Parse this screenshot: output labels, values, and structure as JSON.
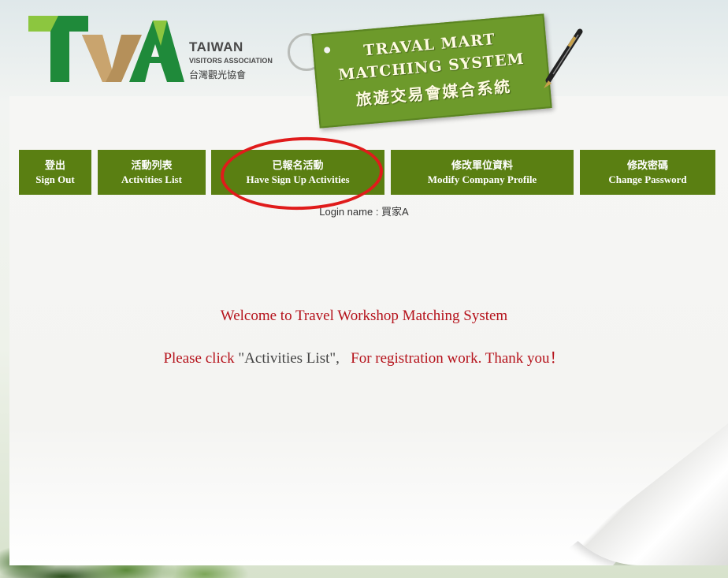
{
  "header": {
    "org_name_en": "TAIWAN",
    "org_subtitle_en": "VISITORS ASSOCIATION",
    "org_name_zh": "台灣觀光協會",
    "tag_line1": "TRAVAL MART",
    "tag_line2": "MATCHING SYSTEM",
    "tag_line3": "旅遊交易會媒合系統"
  },
  "nav": {
    "items": [
      {
        "zh": "登出",
        "en": "Sign Out"
      },
      {
        "zh": "活動列表",
        "en": "Activities List"
      },
      {
        "zh": "已報名活動",
        "en": "Have Sign Up Activities"
      },
      {
        "zh": "修改單位資料",
        "en": "Modify Company Profile"
      },
      {
        "zh": "修改密碼",
        "en": "Change Password"
      }
    ]
  },
  "login": {
    "label": "Login name : 買家A"
  },
  "main": {
    "welcome": "Welcome to Travel Workshop Matching System",
    "please_part1": "Please click ",
    "please_quote": "\"Activities List\",",
    "please_part2": "   For registration work. Thank you！"
  },
  "colors": {
    "nav_bg": "#5a7f12",
    "message_red": "#b5121b",
    "highlight_circle": "#e01b1b",
    "tag_green": "#6d9a2b"
  }
}
